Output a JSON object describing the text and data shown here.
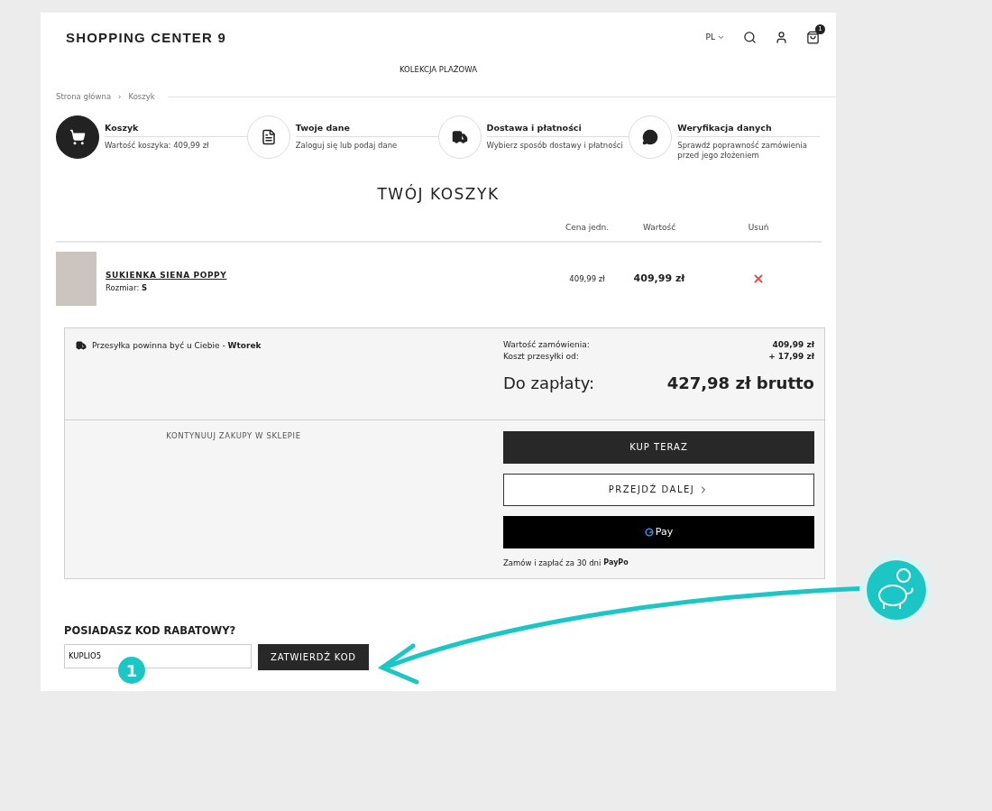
{
  "header": {
    "logo": "SHOPPING CENTER 9",
    "language": "PL",
    "cart_count": "1"
  },
  "nav": {
    "items": [
      "KOLEKCJA PLAŻOWA"
    ]
  },
  "breadcrumb": [
    "Strona główna",
    "›",
    "Koszyk"
  ],
  "steps": [
    {
      "title": "Koszyk",
      "description": "Wartość koszyka: 409,99 zł",
      "kind": "cart",
      "selected": true
    },
    {
      "title": "Twoje dane",
      "description": "Zaloguj się lub podaj dane",
      "kind": "document",
      "selected": false
    },
    {
      "title": "Dostawa i płatności",
      "description": "Wybierz sposób dostawy i płatności",
      "kind": "truck",
      "selected": false
    },
    {
      "title": "Weryfikacja danych",
      "description": "Sprawdź poprawność zamówienia przed jego złożeniem",
      "kind": "chat",
      "selected": false
    }
  ],
  "page_title": "TWÓJ KOSZYK",
  "table": {
    "columns": [
      "Cena jedn.",
      "Wartość",
      "Usuń"
    ],
    "rows": [
      {
        "name": "SUKIENKA SIENA POPPY",
        "size_label": "Rozmiar: ",
        "size": "S",
        "unit_price": "409,99 zł",
        "total": "409,99 zł"
      }
    ]
  },
  "summary": {
    "delivery": "Przesyłka powinna być u Ciebie - **Wtorek**",
    "lines": [
      {
        "label": "Wartość zamówienia:",
        "value": "409,99 zł"
      },
      {
        "label": "Koszt przesyłki od:",
        "value": "+ 17,99 zł"
      }
    ],
    "total_label": "Do zapłaty:",
    "total_value": "427,98 zł brutto",
    "continue_link": "KONTYNUUJ ZAKUPY W SKLEPIE",
    "buy_button": "KUP TERAZ",
    "next_button": "PRZEJDŹ DALEJ",
    "gpay_button": "Pay",
    "paypo_text": "Zamów i zapłać za 30 dni",
    "paypo_logo": "PayPo"
  },
  "discount": {
    "heading": "POSIADASZ KOD RABATOWY?",
    "value": "KUPLIO5",
    "button": "ZATWIERDŹ KOD"
  },
  "annotation": {
    "step_number": "1"
  }
}
